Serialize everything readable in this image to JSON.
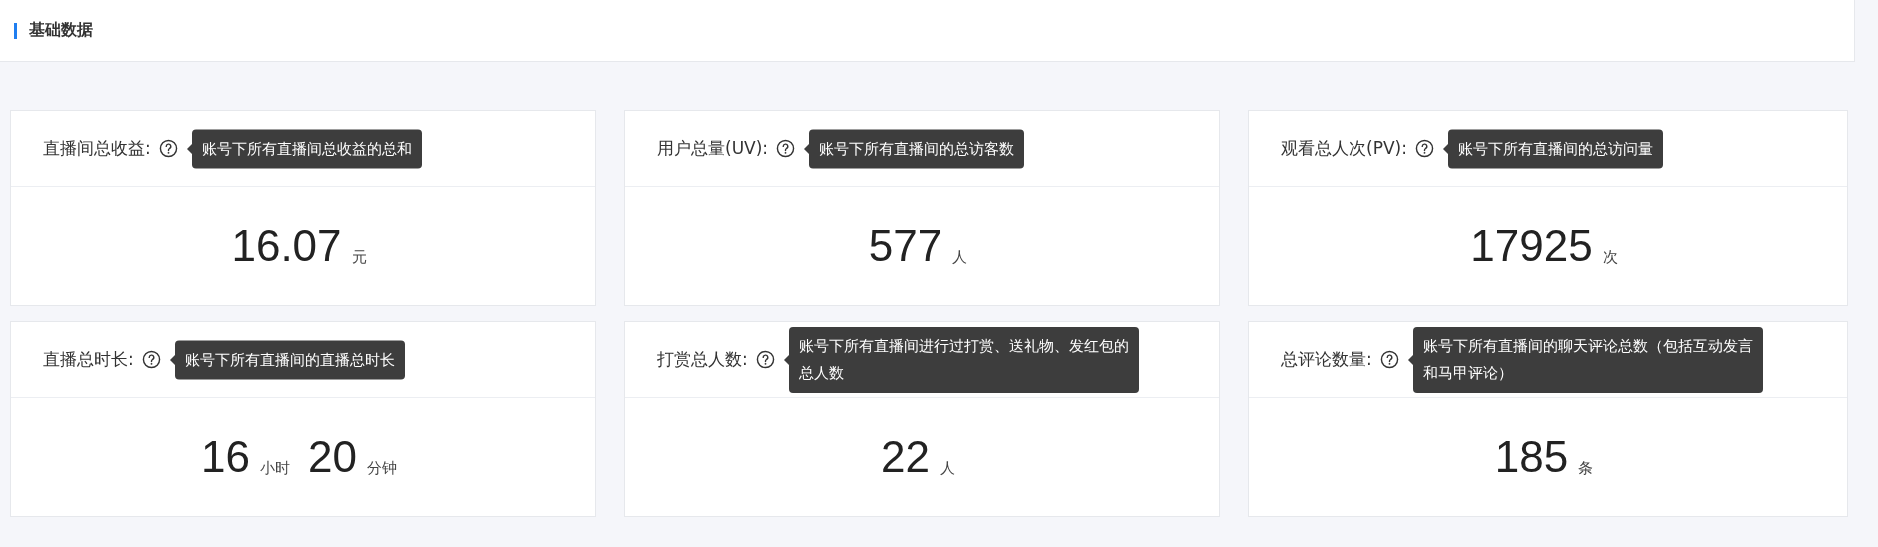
{
  "section": {
    "title": "基础数据"
  },
  "cards": [
    {
      "label": "直播间总收益:",
      "tooltip": "账号下所有直播间总收益的总和",
      "value": [
        {
          "number": "16.07",
          "unit": "元"
        }
      ]
    },
    {
      "label": "用户总量(UV):",
      "tooltip": "账号下所有直播间的总访客数",
      "value": [
        {
          "number": "577",
          "unit": "人"
        }
      ]
    },
    {
      "label": "观看总人次(PV):",
      "tooltip": "账号下所有直播间的总访问量",
      "value": [
        {
          "number": "17925",
          "unit": "次"
        }
      ]
    },
    {
      "label": "直播总时长:",
      "tooltip": "账号下所有直播间的直播总时长",
      "value": [
        {
          "number": "16",
          "unit": "小时"
        },
        {
          "number": "20",
          "unit": "分钟"
        }
      ]
    },
    {
      "label": "打赏总人数:",
      "tooltip": "账号下所有直播间进行过打赏、送礼物、发红包的总人数",
      "value": [
        {
          "number": "22",
          "unit": "人"
        }
      ]
    },
    {
      "label": "总评论数量:",
      "tooltip": "账号下所有直播间的聊天评论总数（包括互动发言和马甲评论）",
      "value": [
        {
          "number": "185",
          "unit": "条"
        }
      ]
    }
  ]
}
